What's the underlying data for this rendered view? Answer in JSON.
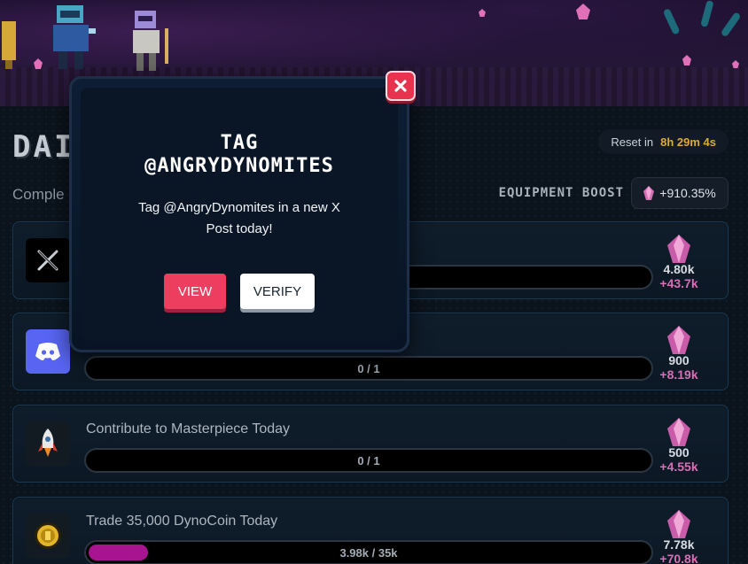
{
  "page": {
    "heading": "DAI",
    "subtext": "Comple",
    "reset_label": "Reset in",
    "reset_time": "8h 29m 4s",
    "boost_label": "EQUIPMENT BOOST",
    "boost_value": "+910.35%"
  },
  "tasks": [
    {
      "icon": "x-logo-icon",
      "title": "",
      "progress": "",
      "progress_fraction": 0,
      "reward": "4.80k",
      "bonus": "+43.7k"
    },
    {
      "icon": "discord-icon",
      "title": "",
      "progress": "0 / 1",
      "progress_fraction": 0,
      "reward": "900",
      "bonus": "+8.19k"
    },
    {
      "icon": "rocket-icon",
      "title": "Contribute to Masterpiece Today",
      "progress": "0 / 1",
      "progress_fraction": 0,
      "reward": "500",
      "bonus": "+4.55k"
    },
    {
      "icon": "dynocoin-icon",
      "title": "Trade 35,000 DynoCoin Today",
      "progress": "3.98k / 35k",
      "progress_fraction": 0.114,
      "reward": "7.78k",
      "bonus": "+70.8k"
    }
  ],
  "modal": {
    "title_line1": "TAG",
    "title_line2": "@ANGRYDYNOMITES",
    "description": "Tag @AngryDynomites in a new X Post today!",
    "view_label": "VIEW",
    "verify_label": "VERIFY"
  },
  "colors": {
    "accent_pink": "#ee3e60",
    "gem_pink": "#d86fb5",
    "timer_gold": "#e0a93a",
    "progress_fill": "#a8148f"
  }
}
